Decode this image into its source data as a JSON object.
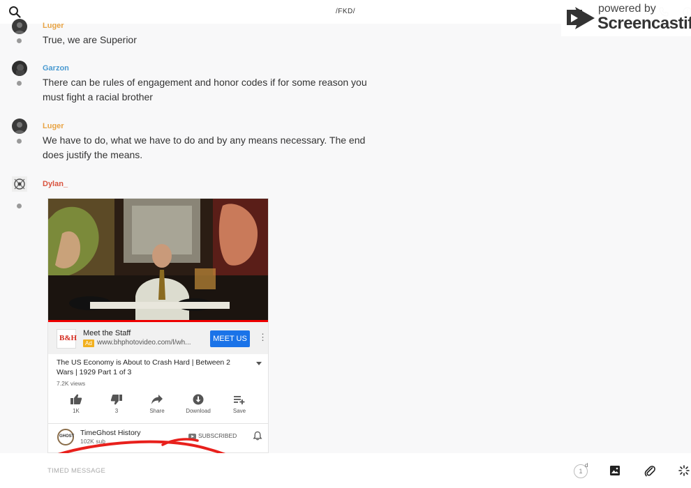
{
  "header": {
    "channel_title": "/FKD/"
  },
  "watermark": {
    "powered": "powered by",
    "brand": "Screencastify"
  },
  "messages": [
    {
      "user": "Luger",
      "text": "True, we are Superior"
    },
    {
      "user": "Garzon",
      "text": "There can be rules of engagement and honor codes if for some reason you must fight a racial brother"
    },
    {
      "user": "Luger",
      "text": "We have to do, what we have to do and by any means necessary. The end does justify the means."
    },
    {
      "user": "Dylan_",
      "text": ""
    }
  ],
  "user_colors": {
    "Luger": "#e8a445",
    "Garzon": "#4a9ad1",
    "Dylan_": "#d9533f"
  },
  "embed": {
    "ad": {
      "logo_text": "B&H",
      "title": "Meet the Staff",
      "badge": "Ad",
      "url": "www.bhphotovideo.com/l/wh...",
      "cta": "MEET US",
      "more": "⋮"
    },
    "video": {
      "title": "The US Economy is About to Crash Hard | Between 2 Wars | 1929 Part 1 of 3",
      "views": "7.2K views"
    },
    "actions": [
      {
        "label": "1K",
        "icon": "thumbs-up-icon"
      },
      {
        "label": "3",
        "icon": "thumbs-down-icon"
      },
      {
        "label": "Share",
        "icon": "share-icon"
      },
      {
        "label": "Download",
        "icon": "download-icon"
      },
      {
        "label": "Save",
        "icon": "playlist-add-icon"
      }
    ],
    "channel": {
      "name": "TimeGhost History",
      "subs": "102K sub",
      "subscribed": "SUBSCRIBED",
      "avatar_text": "GHOST"
    }
  },
  "composer": {
    "placeholder": "TIMED MESSAGE",
    "timer_value": "1",
    "timer_unit": "d"
  }
}
